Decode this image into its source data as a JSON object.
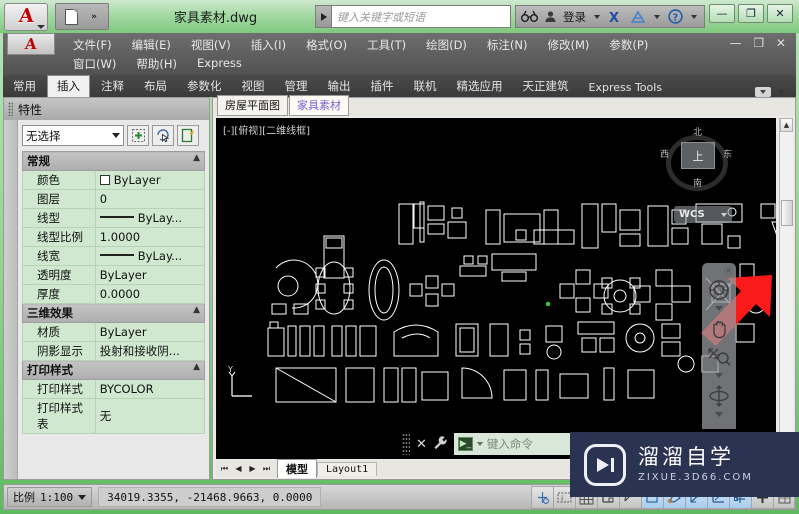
{
  "titlebar": {
    "app_glyph": "A",
    "document_name": "家具素材.dwg",
    "search_placeholder": "键入关键字或短语",
    "sign_in": "登录",
    "quick_access": [
      "new-file-icon",
      "more-icon"
    ],
    "right_icons": [
      "binoculars-icon",
      "person-icon",
      "exchange-icon",
      "cloud-icon",
      "help-icon"
    ],
    "help_glyph": "?",
    "window_buttons": {
      "minimize": "—",
      "maximize": "❐",
      "close": "✕"
    }
  },
  "menubar": {
    "row1": [
      "文件(F)",
      "编辑(E)",
      "视图(V)",
      "插入(I)",
      "格式(O)",
      "工具(T)",
      "绘图(D)",
      "标注(N)",
      "修改(M)",
      "参数(P)"
    ],
    "row2": [
      "窗口(W)",
      "帮助(H)",
      "Express"
    ],
    "window_controls": "— ❐ ✕"
  },
  "ribbon": {
    "tabs": [
      {
        "label": "常用",
        "active": false
      },
      {
        "label": "插入",
        "active": true
      },
      {
        "label": "注释",
        "active": false
      },
      {
        "label": "布局",
        "active": false
      },
      {
        "label": "参数化",
        "active": false
      },
      {
        "label": "视图",
        "active": false
      },
      {
        "label": "管理",
        "active": false
      },
      {
        "label": "输出",
        "active": false
      },
      {
        "label": "插件",
        "active": false
      },
      {
        "label": "联机",
        "active": false
      },
      {
        "label": "精选应用",
        "active": false
      },
      {
        "label": "天正建筑",
        "active": false
      },
      {
        "label": "Express Tools",
        "active": false
      }
    ]
  },
  "properties": {
    "title": "特性",
    "selection": "无选择",
    "toolbar_icons": [
      "quick-select-icon",
      "select-objects-icon",
      "pickadd-icon"
    ],
    "groups": [
      {
        "name": "常规",
        "rows": [
          {
            "key": "颜色",
            "value": "ByLayer",
            "swatch": true
          },
          {
            "key": "图层",
            "value": "0"
          },
          {
            "key": "线型",
            "value": "ByLay...",
            "line": true
          },
          {
            "key": "线型比例",
            "value": "1.0000"
          },
          {
            "key": "线宽",
            "value": "ByLay...",
            "line": true
          },
          {
            "key": "透明度",
            "value": "ByLayer"
          },
          {
            "key": "厚度",
            "value": "0.0000"
          }
        ]
      },
      {
        "name": "三维效果",
        "rows": [
          {
            "key": "材质",
            "value": "ByLayer"
          },
          {
            "key": "阴影显示",
            "value": "投射和接收阴..."
          }
        ]
      },
      {
        "name": "打印样式",
        "rows": [
          {
            "key": "打印样式",
            "value": "BYCOLOR"
          },
          {
            "key": "打印样式表",
            "value": "无"
          }
        ]
      }
    ]
  },
  "drawing": {
    "file_tabs": [
      {
        "label": "房屋平面图",
        "active": false
      },
      {
        "label": "家具素材",
        "active": true
      }
    ],
    "viewport_label": "[-][俯视][二维线框]",
    "ucs_label": "Y",
    "viewcube": {
      "face": "上",
      "north": "北",
      "south": "南",
      "east": "东",
      "west": "西"
    },
    "wcs_label": "WCS",
    "nav_tools": [
      "steering-wheel-icon",
      "pan-hand-icon",
      "zoom-extents-icon",
      "orbit-icon"
    ],
    "annotation": "red-arrow-icon"
  },
  "command": {
    "close_icon": "✕",
    "settings_icon": "wrench-icon",
    "prompt_glyph": "▶_",
    "placeholder": "键入命令"
  },
  "model_tabs": {
    "nav": [
      "⏮",
      "◀",
      "▶",
      "⏭"
    ],
    "tabs": [
      {
        "label": "模型",
        "active": true
      },
      {
        "label": "Layout1",
        "active": false
      }
    ]
  },
  "statusbar": {
    "scale_label": "比例",
    "scale_value": "1:100",
    "coordinates": "34019.3355,  -21468.9663,  0.0000",
    "toggles": [
      {
        "name": "infer-constraints-icon",
        "on": false
      },
      {
        "name": "dynamic-input-icon",
        "on": false
      },
      {
        "name": "grid-display-icon",
        "on": false
      },
      {
        "name": "snap-mode-icon",
        "on": false
      },
      {
        "name": "ortho-mode-icon",
        "on": false
      },
      {
        "name": "polar-tracking-icon",
        "on": true
      },
      {
        "name": "object-snap-icon",
        "on": true
      },
      {
        "name": "3d-object-snap-icon",
        "on": true
      },
      {
        "name": "object-snap-tracking-icon",
        "on": true
      },
      {
        "name": "dynamic-ucs-icon",
        "on": true
      },
      {
        "name": "lineweight-icon",
        "on": false
      },
      {
        "name": "transparency-icon",
        "on": false
      }
    ]
  },
  "watermark": {
    "title": "溜溜自学",
    "subtitle": "ZIXUE.3D66.COM"
  },
  "colors": {
    "window_frame": "#8fd48f",
    "ribbon_dark": "#3a3a3a",
    "prop_value_bg": "#cfe8cf",
    "canvas_bg": "#000000",
    "accent_red": "#ff1c1c",
    "watermark_bg": "#2b3352"
  }
}
